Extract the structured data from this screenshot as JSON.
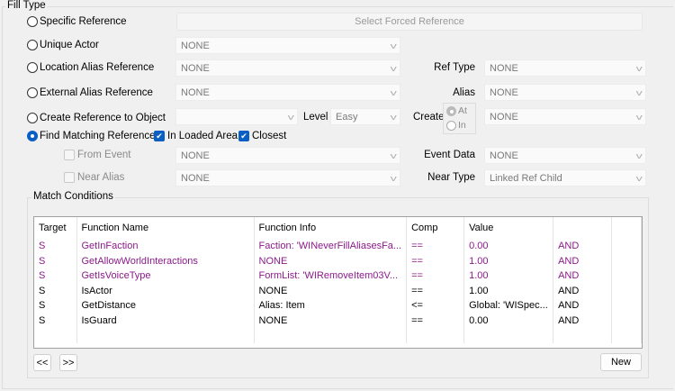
{
  "fill_type": {
    "title": "Fill Type",
    "specific_reference": "Specific Reference",
    "select_forced_reference": "Select Forced Reference",
    "unique_actor": "Unique Actor",
    "unique_actor_value": "NONE",
    "location_alias_reference": "Location Alias Reference",
    "location_alias_value": "NONE",
    "external_alias_reference": "External Alias Reference",
    "external_alias_value": "NONE",
    "create_reference": "Create Reference to Object",
    "create_reference_value": "",
    "level_label": "Level",
    "level_value": "Easy",
    "find_matching": "Find Matching Reference",
    "in_loaded_area": "In Loaded Area",
    "closest": "Closest",
    "from_event": "From Event",
    "from_event_value": "NONE",
    "near_alias": "Near Alias",
    "near_alias_value": "NONE",
    "ref_type_label": "Ref Type",
    "ref_type_value": "NONE",
    "alias_label": "Alias",
    "alias_value": "NONE",
    "create_label": "Create",
    "at": "At",
    "in": "In",
    "create_value": "NONE",
    "event_data_label": "Event Data",
    "event_data_value": "NONE",
    "near_type_label": "Near Type",
    "near_type_value": "Linked Ref Child"
  },
  "match_conditions": {
    "title": "Match Conditions",
    "columns": [
      "Target",
      "Function Name",
      "Function Info",
      "Comp",
      "Value",
      ""
    ],
    "rows": [
      {
        "target": "S",
        "name": "GetInFaction",
        "info": "Faction: 'WINeverFillAliasesFa...",
        "comp": "==",
        "value": "0.00",
        "op": "AND",
        "highlight": true
      },
      {
        "target": "S",
        "name": "GetAllowWorldInteractions",
        "info": "NONE",
        "comp": "==",
        "value": "1.00",
        "op": "AND",
        "highlight": true
      },
      {
        "target": "S",
        "name": "GetIsVoiceType",
        "info": "FormList: 'WIRemoveItem03V...",
        "comp": "==",
        "value": "1.00",
        "op": "AND",
        "highlight": true
      },
      {
        "target": "S",
        "name": "IsActor",
        "info": "NONE",
        "comp": "==",
        "value": "1.00",
        "op": "AND",
        "highlight": false
      },
      {
        "target": "S",
        "name": "GetDistance",
        "info": "Alias: Item",
        "comp": "<=",
        "value": "Global: 'WISpec...",
        "op": "AND",
        "highlight": false
      },
      {
        "target": "S",
        "name": "IsGuard",
        "info": "NONE",
        "comp": "==",
        "value": "0.00",
        "op": "AND",
        "highlight": false
      }
    ],
    "prev": "<<",
    "next": ">>",
    "new": "New"
  }
}
